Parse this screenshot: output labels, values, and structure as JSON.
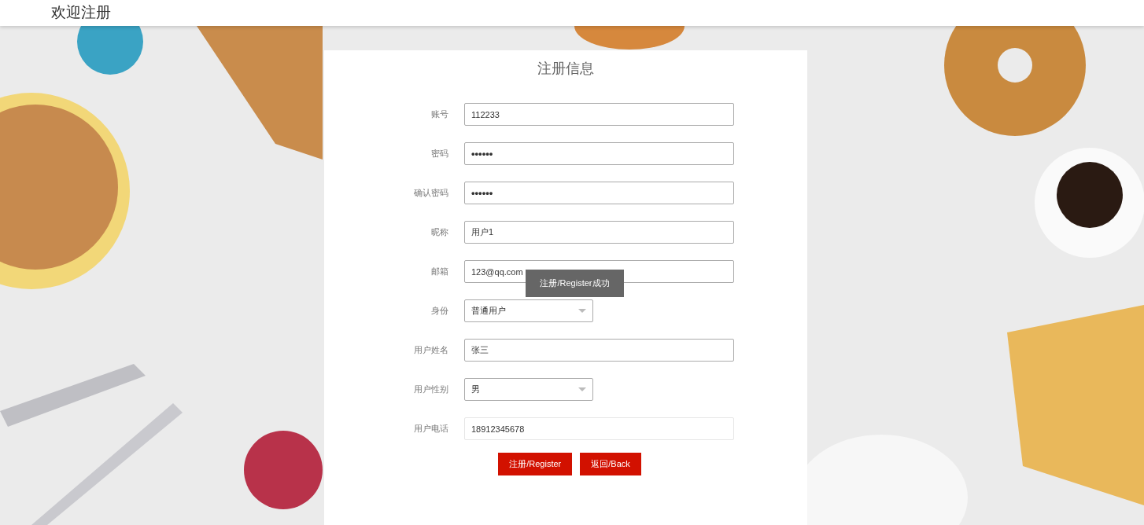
{
  "header": {
    "title": "欢迎注册"
  },
  "form": {
    "title": "注册信息",
    "fields": [
      {
        "label": "账号",
        "kind": "text",
        "value": "112233"
      },
      {
        "label": "密码",
        "kind": "password",
        "value": "••••••"
      },
      {
        "label": "确认密码",
        "kind": "password",
        "value": "••••••"
      },
      {
        "label": "昵称",
        "kind": "text",
        "value": "用户1"
      },
      {
        "label": "邮箱",
        "kind": "text",
        "value": "123@qq.com"
      },
      {
        "label": "身份",
        "kind": "select",
        "value": "普通用户"
      },
      {
        "label": "用户姓名",
        "kind": "text",
        "value": "张三"
      },
      {
        "label": "用户性别",
        "kind": "select",
        "value": "男"
      },
      {
        "label": "用户电话",
        "kind": "text",
        "value": "18912345678"
      }
    ],
    "buttons": [
      "注册/Register",
      "返回/Back"
    ]
  },
  "toast": {
    "text": "注册/Register成功"
  }
}
